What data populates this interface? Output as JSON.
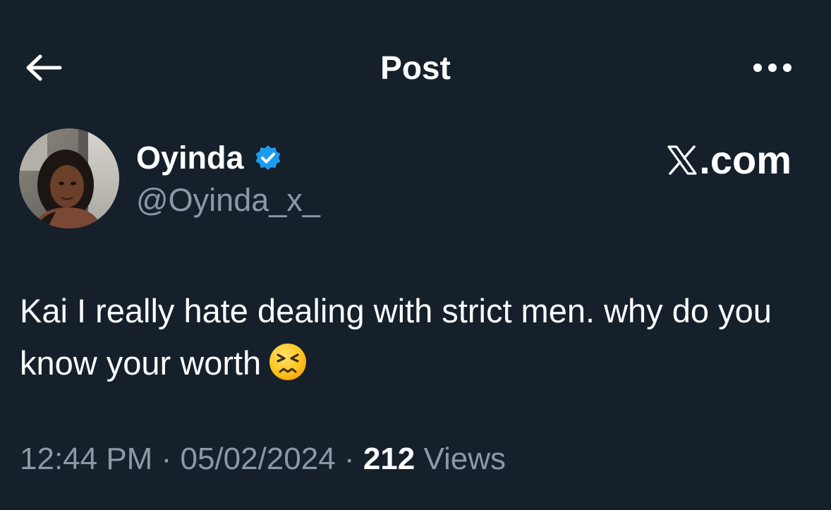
{
  "header": {
    "title": "Post",
    "back_icon": "arrow-left-icon",
    "more_icon": "more-dots-icon"
  },
  "author": {
    "display_name": "Oyinda",
    "handle": "@Oyinda_x_",
    "verified": true,
    "verified_color": "#1d9bf0",
    "avatar_icon": "avatar-photo"
  },
  "brand": {
    "label": ".com",
    "icon": "x-logo-icon"
  },
  "post": {
    "text": "Kai I really hate dealing with strict men. why do you know your worth",
    "emoji_icon": "persevering-face-emoji"
  },
  "meta": {
    "time": "12:44 PM",
    "separator": "·",
    "date": "05/02/2024",
    "views_count": "212",
    "views_label": "Views"
  },
  "colors": {
    "background": "#15202b",
    "text_primary": "#ffffff",
    "text_secondary": "#8b98a5"
  }
}
